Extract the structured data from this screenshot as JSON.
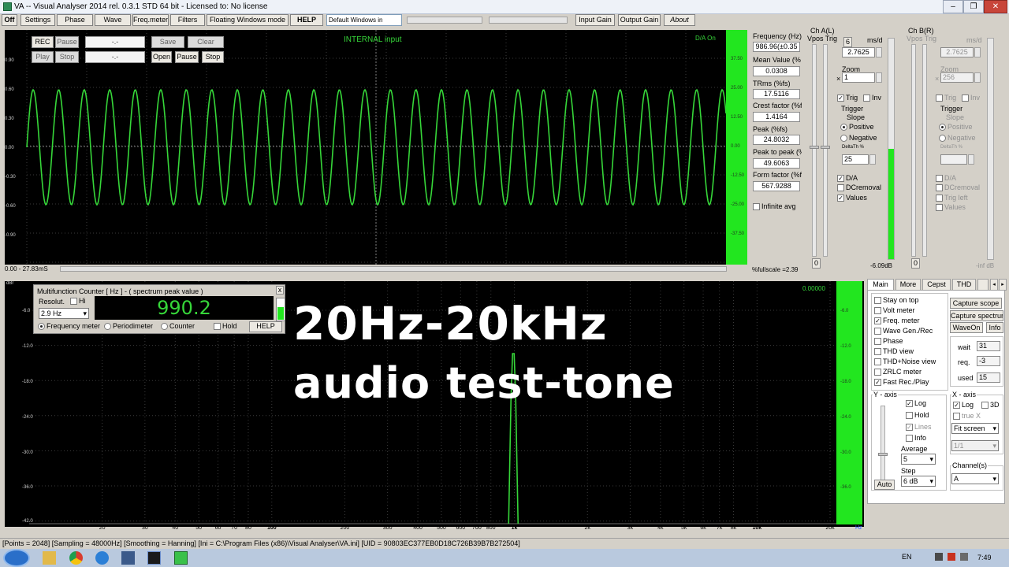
{
  "window": {
    "title": "VA -- Visual Analyser 2014 rel. 0.3.1 STD 64 bit - Licensed to: No license",
    "min": "–",
    "max": "❐",
    "close": "✕"
  },
  "toolbar": {
    "off": "Off",
    "settings": "Settings",
    "phase": "Phase",
    "wave": "Wave",
    "freqmeter": "Freq.meter",
    "filters": "Filters",
    "floating": "Floating Windows mode",
    "help": "HELP",
    "layout": "Default Windows in",
    "input_gain": "Input Gain",
    "output_gain": "Output Gain",
    "about": "About"
  },
  "scope": {
    "title": "INTERNAL input",
    "da": "D/A On",
    "buttons": {
      "rec": "REC",
      "pause": "Pause",
      "save": "Save",
      "clear": "Clear",
      "play": "Play",
      "stop": "Stop",
      "open": "Open",
      "pause2": "Pause",
      "stop2": "Stop"
    },
    "field1": "-.-",
    "field2": "-.-",
    "ylabels": [
      "0.90",
      "0.60",
      "0.30",
      "0.00",
      "-0.30",
      "-0.60",
      "-0.90"
    ],
    "rlabels": [
      "37.50",
      "25.00",
      "12.50",
      "0.00",
      "-12.50",
      "-25.00",
      "-37.50"
    ],
    "time_range": "0.00 - 27.83mS",
    "fullscale": "%fullscale =2.39"
  },
  "stats": [
    {
      "label": "Frequency (Hz)",
      "value": "986.96(±0.35"
    },
    {
      "label": "Mean Value (%",
      "value": "0.0308"
    },
    {
      "label": "TRms (%fs)",
      "value": "17.5116"
    },
    {
      "label": "Crest factor (%f",
      "value": "1.4164"
    },
    {
      "label": "Peak (%fs)",
      "value": "24.8032"
    },
    {
      "label": "Peak to peak (%",
      "value": "49.6063"
    },
    {
      "label": "Form factor (%f",
      "value": "567.9288"
    }
  ],
  "infinite_avg": "Infinite avg",
  "chA": {
    "title": "Ch A(L)",
    "vpos": "Vpos Trig",
    "ms": "ms/d",
    "ms_val": "2.7625",
    "zoom": "Zoom",
    "zoom_x": "×",
    "zoom_val": "1",
    "trig": "Trig",
    "inv": "Inv",
    "trigger": "Trigger",
    "slope": "Slope",
    "positive": "Positive",
    "negative": "Negative",
    "delta": "DeltaTh %",
    "delta_val": "25",
    "da": "D/A",
    "dc": "DCremoval",
    "values": "Values",
    "zero": "0",
    "btn6": "6",
    "db": "-6.09dB"
  },
  "chB": {
    "title": "Ch B(R)",
    "vpos": "Vpos Trig",
    "ms": "ms/d",
    "ms_val": "2.7625",
    "zoom": "Zoom",
    "zoom_x": "×",
    "zoom_val": "256",
    "trig": "Trig",
    "inv": "Inv",
    "trigger": "Trigger",
    "slope": "Slope",
    "positive": "Positive",
    "negative": "Negative",
    "delta": "DeltaTh %",
    "da": "D/A",
    "dc": "DCremoval",
    "trigleft": "Trig left",
    "values": "Values",
    "zero": "0",
    "db": "-inf dB"
  },
  "mfc": {
    "title": "Multifunction Counter [ Hz ] - ( spectrum peak value )",
    "resol": "Resolut.",
    "hi": "Hi",
    "res_val": "2.9 Hz",
    "value": "990.2",
    "freq": "Frequency meter",
    "period": "Periodimeter",
    "counter": "Counter",
    "hold": "Hold",
    "help": "HELP",
    "close": "x"
  },
  "spectrum": {
    "dbr": "dBr",
    "peak": "0.00000",
    "hz": "Hz",
    "ylabels": [
      "-6.0",
      "-12.0",
      "-18.0",
      "-24.0",
      "-30.0",
      "-36.0",
      "-42.0"
    ],
    "rlabels": [
      "-6.0",
      "-12.0",
      "-18.0",
      "-24.0",
      "-30.0",
      "-36.0",
      "-42.0"
    ],
    "xlabels": [
      "20",
      "30",
      "40",
      "50",
      "60",
      "70",
      "80",
      "100",
      "200",
      "300",
      "400",
      "500",
      "600",
      "700",
      "800",
      "1k",
      "2k",
      "3k",
      "4k",
      "5k",
      "6k",
      "7k",
      "8k",
      "10k",
      "20k"
    ]
  },
  "overlay": {
    "line1": "20Hz-20kHz",
    "line2": "audio test-tone"
  },
  "tabs": {
    "main": "Main",
    "more": "More",
    "cepst": "Cepst",
    "thd": "THD"
  },
  "rpanel": {
    "checks": [
      "Stay on top",
      "Volt meter",
      "Freq. meter",
      "Wave Gen./Rec",
      "Phase",
      "THD view",
      "THD+Noise view",
      "ZRLC meter",
      "Fast Rec./Play"
    ],
    "capture_scope": "Capture scope",
    "capture_spectrum": "Capture spectrum",
    "waveon": "WaveOn",
    "info": "Info",
    "wait": "wait",
    "wait_val": "31",
    "req": "req.",
    "req_val": "-3",
    "used": "used",
    "used_val": "15",
    "yaxis": "Y - axis",
    "log": "Log",
    "hold": "Hold",
    "lines": "Lines",
    "info2": "Info",
    "average": "Average",
    "avg_val": "5",
    "step": "Step",
    "step_val": "6 dB",
    "auto": "Auto",
    "xaxis": "X - axis",
    "xlog": "Log",
    "x3d": "3D",
    "truex": "true X",
    "fit": "Fit screen",
    "ratio": "1/1",
    "channels": "Channel(s)",
    "ch_val": "A"
  },
  "status": "[Points = 2048]  [Sampling = 48000Hz]  [Smoothing = Hanning]  [Ini = C:\\Program Files (x86)\\Visual Analyser\\VA.ini]  [UID = 90803EC377EB0D18C726B39B7B272504]",
  "taskbar": {
    "lang": "EN",
    "time": "7:49"
  }
}
